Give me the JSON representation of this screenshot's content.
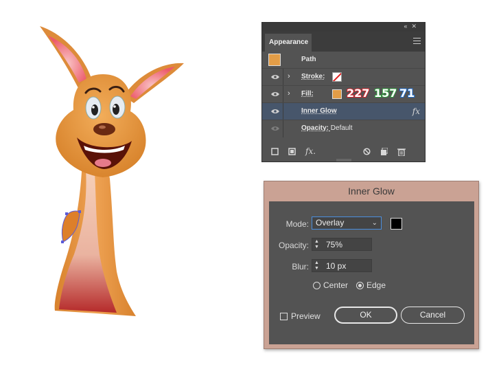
{
  "appearance_panel": {
    "title": "Appearance",
    "titlebar_icons": [
      "collapse-icon",
      "close-icon"
    ],
    "rows": [
      {
        "label": "Path"
      },
      {
        "label": "Stroke:"
      },
      {
        "label": "Fill:",
        "rgb": {
          "r": "227",
          "g": "157",
          "b": "71"
        },
        "swatch_color": "#e39d47"
      },
      {
        "label": "Inner Glow",
        "effect_icon": "fx",
        "selected": true
      },
      {
        "label": "Opacity:",
        "value": "Default"
      }
    ],
    "bottom_icons": [
      "add-stroke-icon",
      "add-fill-icon",
      "add-effect-icon",
      "clear-icon",
      "duplicate-icon",
      "trash-icon"
    ]
  },
  "dialog": {
    "title": "Inner Glow",
    "mode_label": "Mode:",
    "mode_value": "Overlay",
    "glow_color": "#000000",
    "opacity_label": "Opacity:",
    "opacity_value": "75%",
    "blur_label": "Blur:",
    "blur_value": "10 px",
    "center_label": "Center",
    "edge_label": "Edge",
    "selected_source": "Edge",
    "preview_label": "Preview",
    "preview_checked": false,
    "ok_label": "OK",
    "cancel_label": "Cancel"
  }
}
